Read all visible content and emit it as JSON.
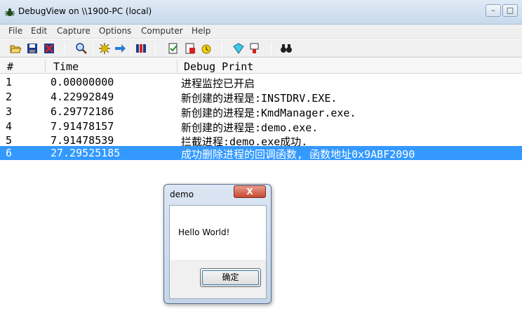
{
  "window": {
    "title": "DebugView on \\\\1900-PC (local)",
    "minimize_glyph": "–",
    "maximize_glyph": "□"
  },
  "menu": [
    "File",
    "Edit",
    "Capture",
    "Options",
    "Computer",
    "Help"
  ],
  "toolbar": {
    "icons": [
      "open-icon",
      "save-icon",
      "clear-icon",
      "find-icon",
      "capture-icon",
      "autoscroll-icon",
      "filter-icon",
      "clock-time-icon",
      "history-icon",
      "highlight-icon",
      "properties-icon",
      "binoculars-icon"
    ]
  },
  "list": {
    "headers": {
      "num": "#",
      "time": "Time",
      "debug": "Debug Print"
    },
    "rows": [
      {
        "num": "1",
        "time": "0.00000000",
        "text": "进程监控已开启"
      },
      {
        "num": "2",
        "time": "4.22992849",
        "text": "新创建的进程是:INSTDRV.EXE."
      },
      {
        "num": "3",
        "time": "6.29772186",
        "text": "新创建的进程是:KmdManager.exe."
      },
      {
        "num": "4",
        "time": "7.91478157",
        "text": "新创建的进程是:demo.exe."
      },
      {
        "num": "5",
        "time": "7.91478539",
        "text": "拦截进程:demo.exe成功."
      },
      {
        "num": "6",
        "time": "27.29525185",
        "text": "成功删除进程的回调函数, 函数地址0x9ABF2090"
      }
    ],
    "selected_row": 6
  },
  "dialog": {
    "title": "demo",
    "close_glyph": "X",
    "message": "Hello World!",
    "ok_label": "确定"
  },
  "colors": {
    "selection": "#3399ff",
    "titlebar": "#dfeaf6",
    "close_button": "#c74a33"
  }
}
